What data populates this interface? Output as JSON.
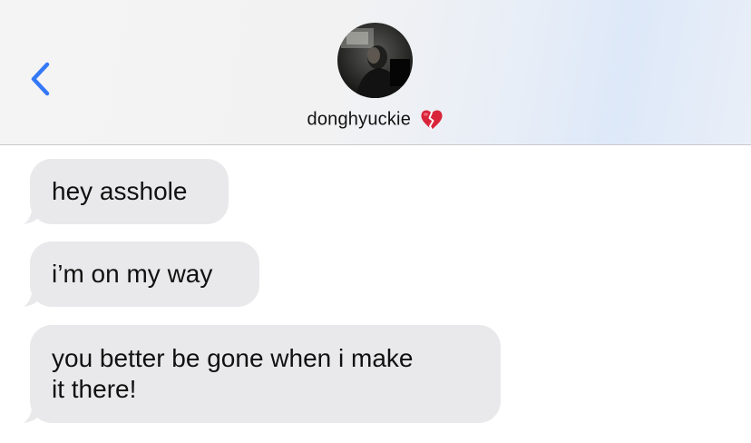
{
  "header": {
    "back_icon": "chevron-left-icon",
    "contact_name": "donghyuckie",
    "contact_emoji": "broken-heart-icon",
    "accent_color": "#3478f6"
  },
  "messages": [
    {
      "text": "hey asshole",
      "sender": "them"
    },
    {
      "text": "i’m on my way",
      "sender": "them"
    },
    {
      "text": "you better be gone when i make\nit there!",
      "sender": "them"
    }
  ],
  "colors": {
    "received_bubble": "#e9e9eb",
    "heart": "#d9253a"
  }
}
